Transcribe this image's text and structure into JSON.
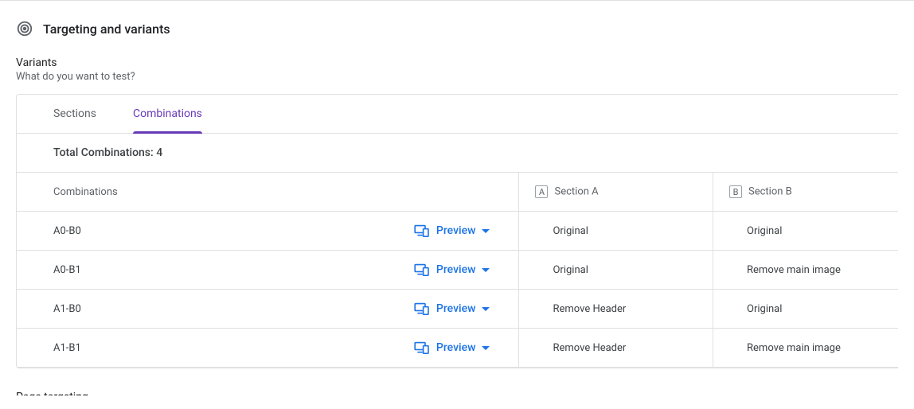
{
  "header": {
    "title": "Targeting and variants"
  },
  "variants_section": {
    "title": "Variants",
    "description": "What do you want to test?"
  },
  "tabs": {
    "sections": "Sections",
    "combinations": "Combinations"
  },
  "totals": {
    "label_prefix": "Total Combinations: ",
    "count": "4"
  },
  "columns": {
    "combinations": "Combinations",
    "a_badge": "A",
    "a_label": "Section A",
    "b_badge": "B",
    "b_label": "Section B"
  },
  "preview_label": "Preview",
  "rows": [
    {
      "combo": "A0-B0",
      "a": "Original",
      "b": "Original"
    },
    {
      "combo": "A0-B1",
      "a": "Original",
      "b": "Remove main image"
    },
    {
      "combo": "A1-B0",
      "a": "Remove Header",
      "b": "Original"
    },
    {
      "combo": "A1-B1",
      "a": "Remove Header",
      "b": "Remove main image"
    }
  ],
  "footer": {
    "page_targeting": "Page targeting"
  }
}
